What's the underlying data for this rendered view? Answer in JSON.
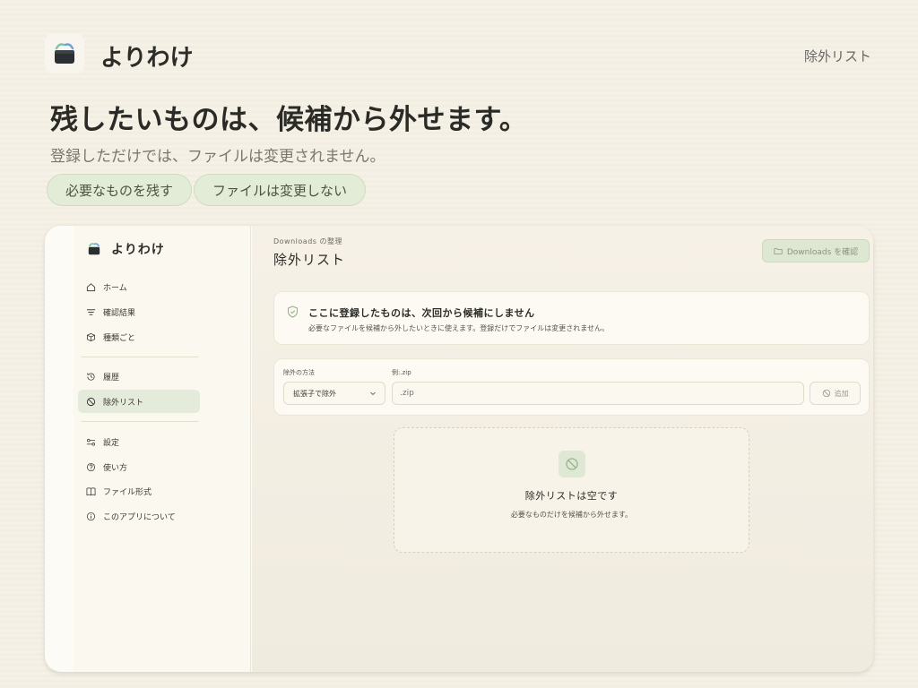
{
  "app": {
    "title": "よりわけ"
  },
  "top_nav": {
    "label": "除外リスト"
  },
  "hero": {
    "title": "残したいものは、候補から外せます。",
    "subtitle": "登録しただけでは、ファイルは変更されません。",
    "pills": [
      "必要なものを残す",
      "ファイルは変更しない"
    ]
  },
  "window": {
    "sidebar": {
      "brand": "よりわけ",
      "items": [
        {
          "label": "ホーム",
          "icon": "home-icon"
        },
        {
          "label": "確認結果",
          "icon": "filter-icon"
        },
        {
          "label": "種類ごと",
          "icon": "box-icon"
        },
        {
          "label": "履歴",
          "icon": "history-icon"
        },
        {
          "label": "除外リスト",
          "icon": "ban-icon",
          "active": true
        },
        {
          "label": "設定",
          "icon": "settings-icon"
        },
        {
          "label": "使い方",
          "icon": "help-icon"
        },
        {
          "label": "ファイル形式",
          "icon": "book-icon"
        },
        {
          "label": "このアプリについて",
          "icon": "info-icon"
        }
      ]
    },
    "main": {
      "breadcrumb": "Downloads の整理",
      "title": "除外リスト",
      "check_button": "Downloads を確認",
      "info": {
        "title": "ここに登録したものは、次回から候補にしません",
        "desc": "必要なファイルを候補から外したいときに使えます。登録だけでファイルは変更されません。"
      },
      "form": {
        "method_label": "除外の方法",
        "method_value": "拡張子で除外",
        "ext_label": "例:.zip",
        "ext_placeholder": ".zip",
        "add_button": "追加"
      },
      "empty": {
        "title": "除外リストは空です",
        "desc": "必要なものだけを候補から外せます。"
      }
    }
  },
  "colors": {
    "accent": "#e2ecd6",
    "accent_border": "#cddcbf",
    "background": "#f6f1e6"
  }
}
